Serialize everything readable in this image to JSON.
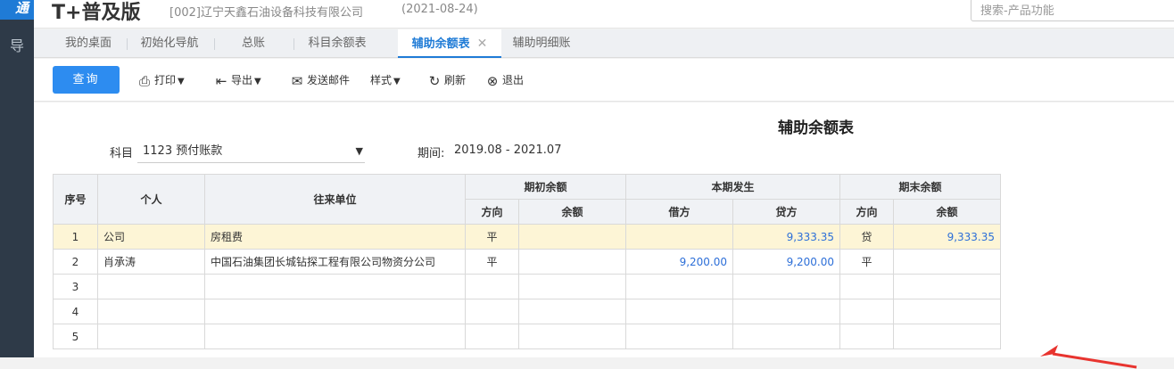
{
  "app": {
    "brand": "T+普及版",
    "logo_text": "通",
    "side_glyph": "导",
    "company": "[002]辽宁天鑫石油设备科技有限公司",
    "date": "(2021-08-24)",
    "search_placeholder": "搜索-产品功能"
  },
  "tabs": [
    {
      "label": "我的桌面"
    },
    {
      "label": "初始化导航"
    },
    {
      "label": "总账"
    },
    {
      "label": "科目余额表"
    },
    {
      "label": "辅助余额表",
      "active": true,
      "close": "✕"
    },
    {
      "label": "辅助明细账"
    }
  ],
  "toolbar": {
    "query": "查询",
    "print": "打印",
    "export": "导出",
    "email": "发送邮件",
    "style": "样式",
    "refresh": "刷新",
    "exit": "退出"
  },
  "report": {
    "title": "辅助余额表",
    "subject_label": "科目",
    "subject_value": "1123 预付账款",
    "period_label": "期间:",
    "period_value": "2019.08 - 2021.07"
  },
  "table": {
    "headers": {
      "seq": "序号",
      "person": "个人",
      "counterparty": "往来单位",
      "opening": "期初余额",
      "current": "本期发生",
      "closing": "期末余额",
      "direction": "方向",
      "balance": "余额",
      "debit": "借方",
      "credit": "贷方"
    },
    "rows": [
      [
        "1",
        "公司",
        "房租费",
        "平",
        "",
        "",
        "9,333.35",
        "贷",
        "9,333.35"
      ],
      [
        "2",
        "肖承涛",
        "中国石油集团长城钻探工程有限公司物资分公司",
        "平",
        "",
        "9,200.00",
        "9,200.00",
        "平",
        ""
      ],
      [
        "3",
        "",
        "",
        "",
        "",
        "",
        "",
        "",
        ""
      ],
      [
        "4",
        "",
        "",
        "",
        "",
        "",
        "",
        "",
        ""
      ],
      [
        "5",
        "",
        "",
        "",
        "",
        "",
        "",
        "",
        ""
      ]
    ]
  },
  "colors": {
    "accent": "#2d8cf0",
    "highlight_row": "#fdf5d6",
    "amount_text": "#2d6fd8",
    "arrow": "#e8342f"
  }
}
